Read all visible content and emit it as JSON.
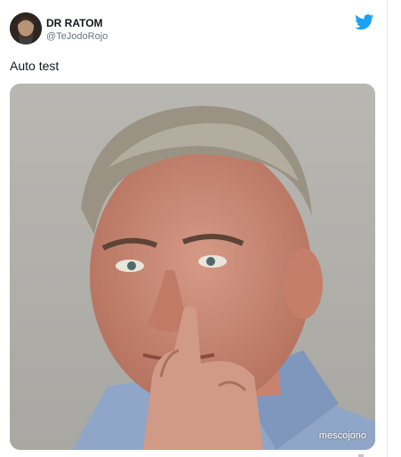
{
  "tweet": {
    "author_name": "DR RATOM",
    "author_handle": "@TeJodoRojo",
    "text": "Auto test",
    "watermark": "mescojono",
    "brand_color": "#1da1f2"
  },
  "icons": {
    "brand": "twitter-bird-icon"
  }
}
